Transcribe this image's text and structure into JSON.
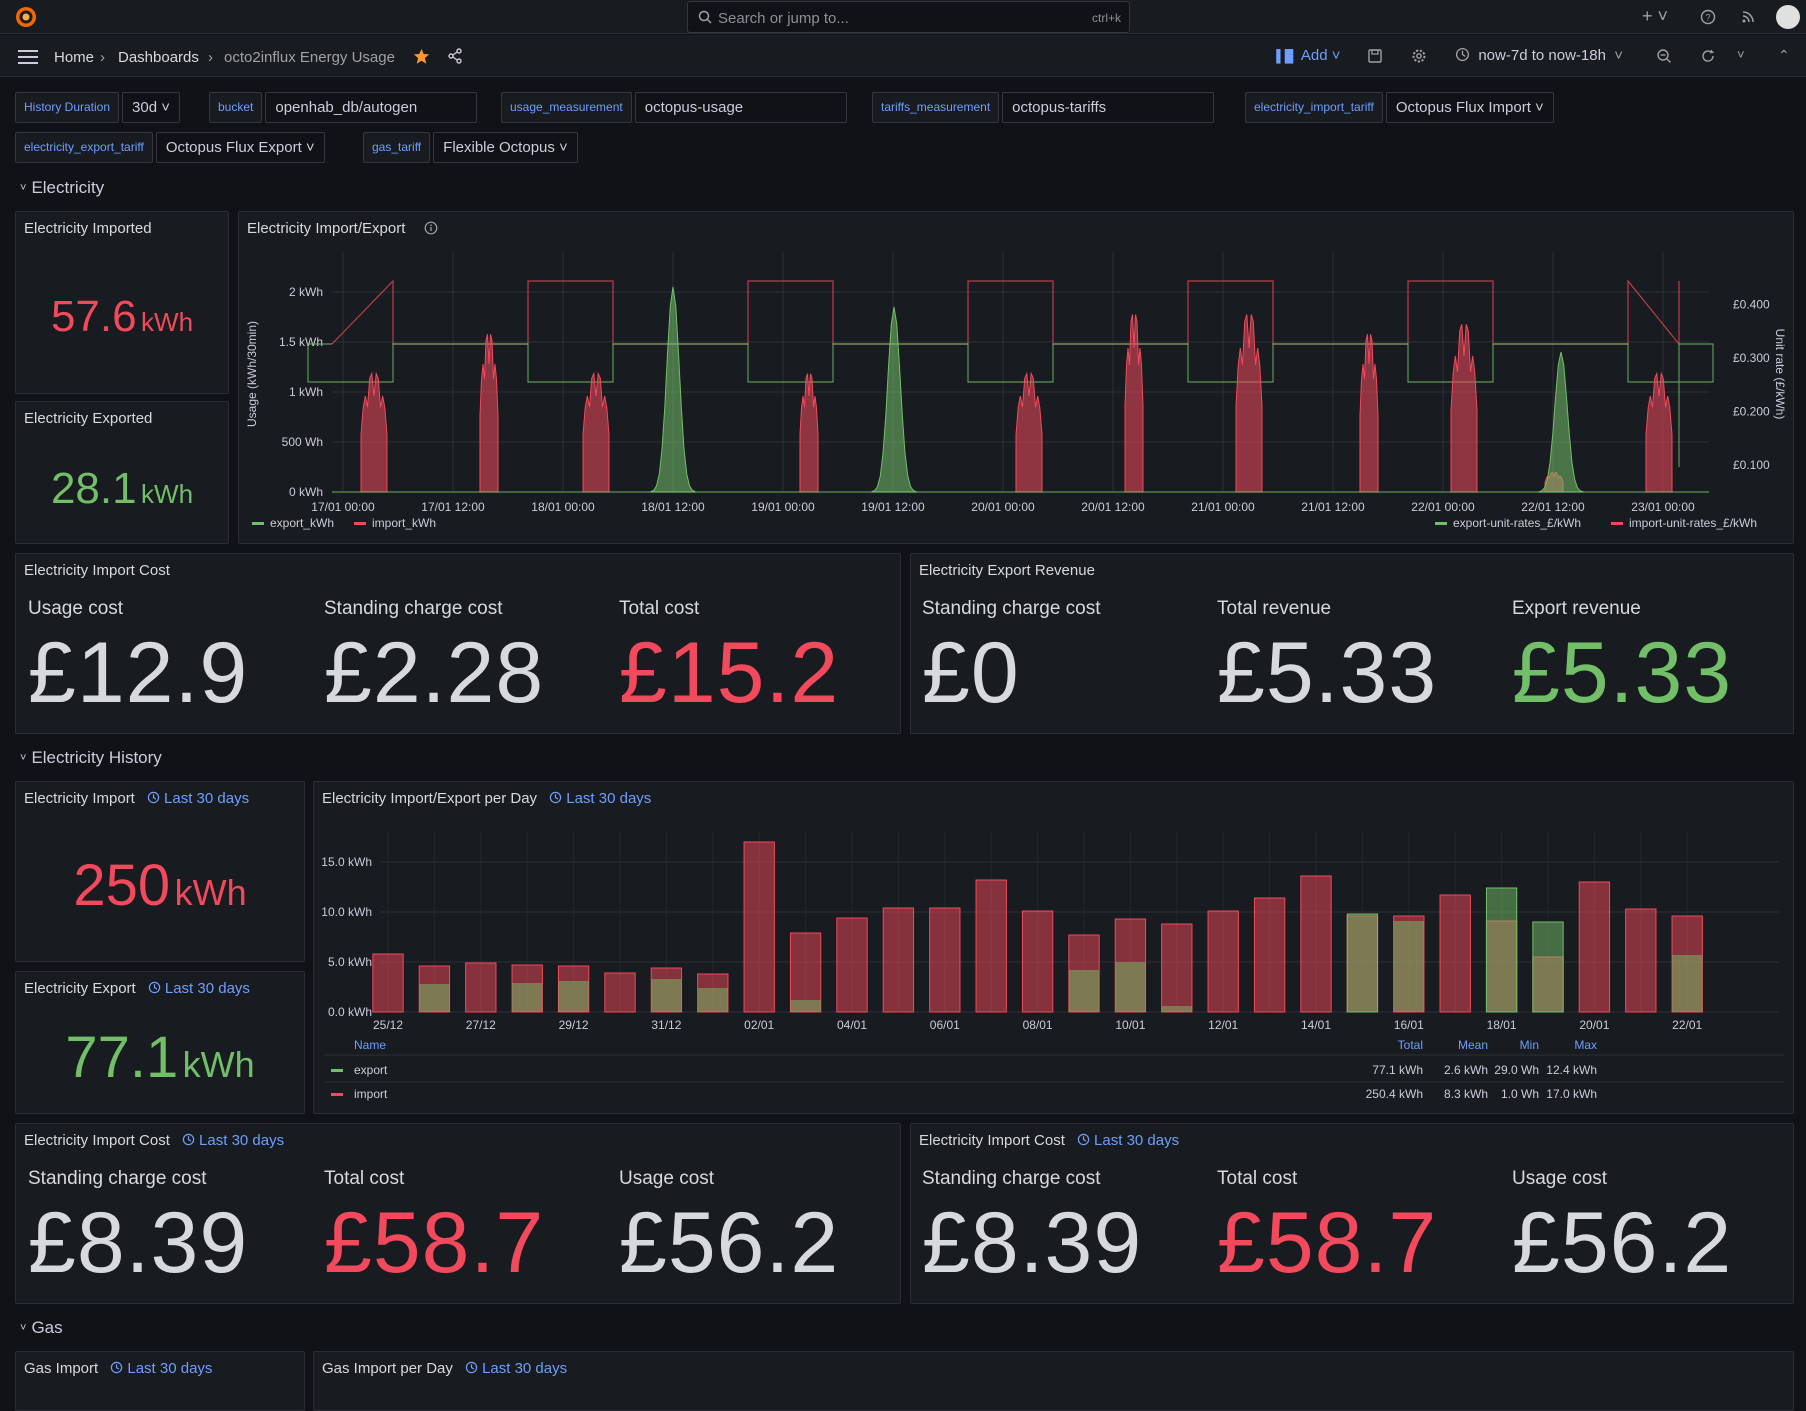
{
  "topbar": {
    "search_placeholder": "Search or jump to...",
    "search_shortcut": "ctrl+k",
    "add_label": "+"
  },
  "breadcrumb": {
    "home": "Home",
    "dashboards": "Dashboards",
    "current": "octo2influx Energy Usage"
  },
  "toolbar": {
    "add_label": "Add",
    "time_range": "now-7d to now-18h"
  },
  "variables": [
    {
      "label": "History Duration",
      "value": "30d"
    },
    {
      "label": "bucket",
      "value": "openhab_db/autogen"
    },
    {
      "label": "usage_measurement",
      "value": "octopus-usage"
    },
    {
      "label": "tariffs_measurement",
      "value": "octopus-tariffs"
    },
    {
      "label": "electricity_import_tariff",
      "value": "Octopus Flux Import"
    },
    {
      "label": "electricity_export_tariff",
      "value": "Octopus Flux Export"
    },
    {
      "label": "gas_tariff",
      "value": "Flexible Octopus"
    }
  ],
  "rows": {
    "electricity": "Electricity",
    "history": "Electricity History",
    "gas": "Gas"
  },
  "panels": {
    "imported": {
      "title": "Electricity Imported",
      "value": "57.6",
      "unit": "kWh"
    },
    "exported": {
      "title": "Electricity Exported",
      "value": "28.1",
      "unit": "kWh"
    },
    "import_export_chart": {
      "title": "Electricity Import/Export"
    },
    "import_cost": {
      "title": "Electricity Import Cost",
      "cells": [
        {
          "label": "Usage cost",
          "value": "£12.9"
        },
        {
          "label": "Standing charge cost",
          "value": "£2.28"
        },
        {
          "label": "Total cost",
          "value": "£15.2"
        }
      ]
    },
    "export_revenue": {
      "title": "Electricity Export Revenue",
      "cells": [
        {
          "label": "Standing charge cost",
          "value": "£0"
        },
        {
          "label": "Total revenue",
          "value": "£5.33"
        },
        {
          "label": "Export revenue",
          "value": "£5.33"
        }
      ]
    },
    "hist_import": {
      "title": "Electricity Import",
      "range": "Last 30 days",
      "value": "250",
      "unit": "kWh"
    },
    "hist_export": {
      "title": "Electricity Export",
      "range": "Last 30 days",
      "value": "77.1",
      "unit": "kWh"
    },
    "per_day": {
      "title": "Electricity Import/Export per Day",
      "range": "Last 30 days"
    },
    "hist_cost_a": {
      "title": "Electricity Import Cost",
      "range": "Last 30 days",
      "cells": [
        {
          "label": "Standing charge cost",
          "value": "£8.39"
        },
        {
          "label": "Total cost",
          "value": "£58.7"
        },
        {
          "label": "Usage cost",
          "value": "£56.2"
        }
      ]
    },
    "hist_cost_b": {
      "title": "Electricity Import Cost",
      "range": "Last 30 days",
      "cells": [
        {
          "label": "Standing charge cost",
          "value": "£8.39"
        },
        {
          "label": "Total cost",
          "value": "£58.7"
        },
        {
          "label": "Usage cost",
          "value": "£56.2"
        }
      ]
    },
    "gas_import": {
      "title": "Gas Import",
      "range": "Last 30 days"
    },
    "gas_per_day": {
      "title": "Gas Import per Day",
      "range": "Last 30 days"
    }
  },
  "colors": {
    "red": "#f2495c",
    "green": "#73bf69",
    "accent": "#6e9fff",
    "star": "#ff9830"
  },
  "chart_data": [
    {
      "type": "line",
      "x_ticks": [
        "17/01 00:00",
        "17/01 12:00",
        "18/01 00:00",
        "18/01 12:00",
        "19/01 00:00",
        "19/01 12:00",
        "20/01 00:00",
        "20/01 12:00",
        "21/01 00:00",
        "21/01 12:00",
        "22/01 00:00",
        "22/01 12:00",
        "23/01 00:00"
      ],
      "y_left_ticks": [
        "0 kWh",
        "500 Wh",
        "1 kWh",
        "1.5 kWh",
        "2 kWh"
      ],
      "ylim_left": [
        0,
        2.0
      ],
      "y_right_ticks": [
        "£0.100",
        "£0.200",
        "£0.300",
        "£0.400"
      ],
      "ylabel": "Usage (kWh/30min)",
      "ylabel_right": "Unit rate (£/kWh)",
      "legend_left": [
        "export_kWh",
        "import_kWh"
      ],
      "legend_right": [
        "export-unit-rates_£/kWh",
        "import-unit-rates_£/kWh"
      ],
      "export_peaks": [
        {
          "day_index": 3,
          "peak_kwh": 2.05
        },
        {
          "day_index": 5,
          "peak_kwh": 1.85
        },
        {
          "day_index": 11,
          "peak_kwh": 1.4
        }
      ],
      "import_peaks_kwh": [
        1.2,
        1.6,
        1.2,
        1.2,
        1.2,
        1.8,
        1.8,
        1.6,
        1.7,
        0.2
      ]
    },
    {
      "type": "bar",
      "categories": [
        "25/12",
        "26/12",
        "27/12",
        "28/12",
        "29/12",
        "30/12",
        "31/12",
        "01/01",
        "02/01",
        "03/01",
        "04/01",
        "05/01",
        "06/01",
        "07/01",
        "08/01",
        "09/01",
        "10/01",
        "11/01",
        "12/01",
        "13/01",
        "14/01",
        "15/01",
        "16/01",
        "17/01",
        "18/01",
        "19/01",
        "20/01",
        "21/01",
        "22/01"
      ],
      "x_tick_labels": [
        "25/12",
        "27/12",
        "29/12",
        "31/12",
        "02/01",
        "04/01",
        "06/01",
        "08/01",
        "10/01",
        "12/01",
        "14/01",
        "16/01",
        "18/01",
        "20/01",
        "22/01"
      ],
      "y_ticks": [
        "0.0 kWh",
        "5.0 kWh",
        "10.0 kWh",
        "15.0 kWh"
      ],
      "ylim": [
        0,
        17.5
      ],
      "series": [
        {
          "name": "import",
          "values": [
            5.8,
            4.6,
            4.9,
            4.7,
            4.6,
            3.9,
            4.4,
            3.8,
            17.0,
            7.9,
            9.4,
            10.4,
            10.4,
            13.2,
            10.1,
            7.7,
            9.3,
            8.8,
            10.1,
            11.4,
            13.6,
            9.6,
            9.6,
            11.7,
            9.1,
            5.5,
            13.0,
            10.3,
            9.6
          ]
        },
        {
          "name": "export",
          "values": [
            0,
            2.8,
            0,
            2.9,
            3.1,
            0,
            3.3,
            2.4,
            0,
            1.2,
            0,
            0,
            0,
            0,
            0,
            4.2,
            5.0,
            0.6,
            0,
            0,
            0,
            9.8,
            9.1,
            0,
            12.4,
            9.0,
            0,
            0,
            5.7
          ]
        }
      ],
      "legend_table": {
        "headers": [
          "Name",
          "Total",
          "Mean",
          "Min",
          "Max"
        ],
        "rows": [
          {
            "name": "export",
            "total": "77.1 kWh",
            "mean": "2.6 kWh",
            "min": "29.0 Wh",
            "max": "12.4 kWh"
          },
          {
            "name": "import",
            "total": "250.4 kWh",
            "mean": "8.3 kWh",
            "min": "1.0 Wh",
            "max": "17.0 kWh"
          }
        ]
      }
    }
  ]
}
